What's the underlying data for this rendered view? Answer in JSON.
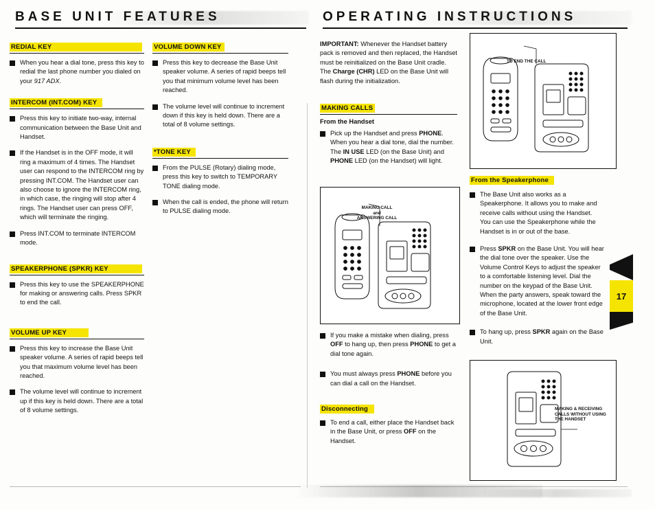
{
  "page": {
    "number": "17",
    "left_header": "BASE UNIT FEATURES",
    "right_header": "OPERATING INSTRUCTIONS"
  },
  "left_column_1": {
    "sections": [
      {
        "title": "REDIAL KEY",
        "bullets": [
          "When you hear a dial tone, press this key to redial the last phone number you dialed on your 917 ADX."
        ]
      },
      {
        "title": "INTERCOM (INT.COM) KEY",
        "bullets": [
          "Press this key to initiate two-way, internal communication between the Base Unit and Handset.",
          "If the Handset is in the OFF mode, it will ring a maximum of 4 times. The Handset user can respond to the INTERCOM ring by pressing INT.COM. The Handset user can also choose to ignore the INTERCOM ring, in which case, the ringing will stop after 4 rings. The Handset user can press OFF, which will terminate the ringing.",
          "Press INT.COM to terminate INTERCOM mode."
        ]
      },
      {
        "title": "SPEAKERPHONE (SPKR) KEY",
        "bullets": [
          "Press this key to use the SPEAKERPHONE for making or answering calls. Press SPKR to end the call."
        ]
      },
      {
        "title": "VOLUME UP KEY",
        "bullets": [
          "Press this key to increase the Base Unit speaker volume. A series of rapid beeps tell you that maximum volume level has been reached.",
          "The volume level will continue to increment up if this key is held down. There are a total of 8 volume settings."
        ]
      }
    ]
  },
  "left_column_2": {
    "sections": [
      {
        "title": "VOLUME DOWN KEY",
        "bullets": [
          "Press this key to decrease the Base Unit speaker volume. A series of rapid beeps tell you that minimum volume level has been reached.",
          "The volume level will continue to increment down if this key is held down. There are a total of 8 volume settings."
        ]
      },
      {
        "title": "*TONE KEY",
        "bullets": [
          "From the PULSE (Rotary) dialing mode, press this key to switch to TEMPORARY TONE dialing mode.",
          "When the call is ended, the phone will return to PULSE dialing mode."
        ]
      }
    ]
  },
  "right_column_1": {
    "important": {
      "lead": "IMPORTANT:",
      "text": " Whenever the Handset battery pack is removed and then replaced, the Handset must be reinitialized on the Base Unit cradle. The Charge (CHR) LED on the Base Unit will flash during the initialization."
    },
    "making_calls_title": "MAKING CALLS",
    "from_handset_title": "From the Handset",
    "from_handset_bullets": [
      "Pick up the Handset and press PHONE. When you hear a dial tone, dial the number. The IN USE LED (on the Base Unit) and PHONE LED (on the Handset) will light."
    ],
    "after_illustration_bullets": [
      "If you make a mistake when dialing, press OFF to hang up, then press PHONE to get a dial tone again.",
      "You must always press PHONE before you can dial a call on the Handset."
    ],
    "disconnecting_title": "Disconnecting",
    "disconnecting_bullets": [
      "To end a call, either place the Handset back in the Base Unit, or press OFF on the Handset."
    ],
    "illustration_caption": "MAKING CALL and ANSWERING CALL"
  },
  "right_column_2": {
    "top_illustration_caption": "TO END THE CALL",
    "speakerphone_title": "From the Speakerphone",
    "bullets": [
      "The Base Unit also works as a Speakerphone. It allows you to make and receive calls without using the Handset. You can use the Speakerphone while the Handset is in or out of the base.",
      "Press SPKR on the Base Unit. You will hear the dial tone over the speaker. Use the Volume Control Keys to adjust the speaker to a comfortable listening level. Dial the number on the keypad of the Base Unit. When the party answers, speak toward the microphone, located at the lower front edge of the Base Unit.",
      "To hang up, press SPKR again on the Base Unit."
    ],
    "bottom_illustration_caption": "MAKING & RECEIVING CALLS WITHOUT USING THE HANDSET"
  }
}
